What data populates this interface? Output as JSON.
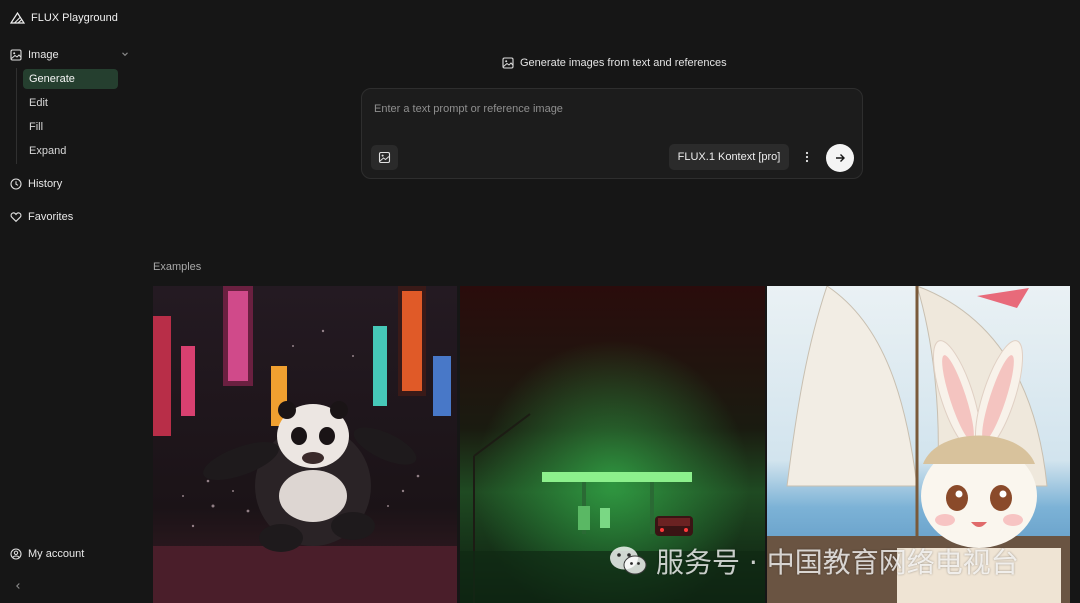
{
  "app": {
    "title": "FLUX Playground"
  },
  "sidebar": {
    "group": {
      "label": "Image",
      "icon": "image-icon"
    },
    "sub_items": [
      {
        "label": "Generate",
        "active": true
      },
      {
        "label": "Edit",
        "active": false
      },
      {
        "label": "Fill",
        "active": false
      },
      {
        "label": "Expand",
        "active": false
      }
    ],
    "items": [
      {
        "label": "History",
        "icon": "clock-icon"
      },
      {
        "label": "Favorites",
        "icon": "heart-icon"
      }
    ],
    "account": {
      "label": "My account",
      "icon": "user-icon"
    }
  },
  "main": {
    "headline": "Generate images from text and references",
    "prompt": {
      "value": "",
      "placeholder": "Enter a text prompt or reference image"
    },
    "model_label": "FLUX.1 Kontext [pro]",
    "examples_label": "Examples",
    "examples": [
      {
        "icon": "panda-image"
      },
      {
        "icon": "gas-station-image"
      },
      {
        "icon": "bunny-ship-image"
      }
    ]
  },
  "watermark": {
    "text": "服务号 · 中国教育网络电视台"
  },
  "colors": {
    "background": "#161616",
    "active_item": "#253f2f",
    "prompt_box": "#1c1c1c",
    "send_button": "#f4f4f4"
  }
}
